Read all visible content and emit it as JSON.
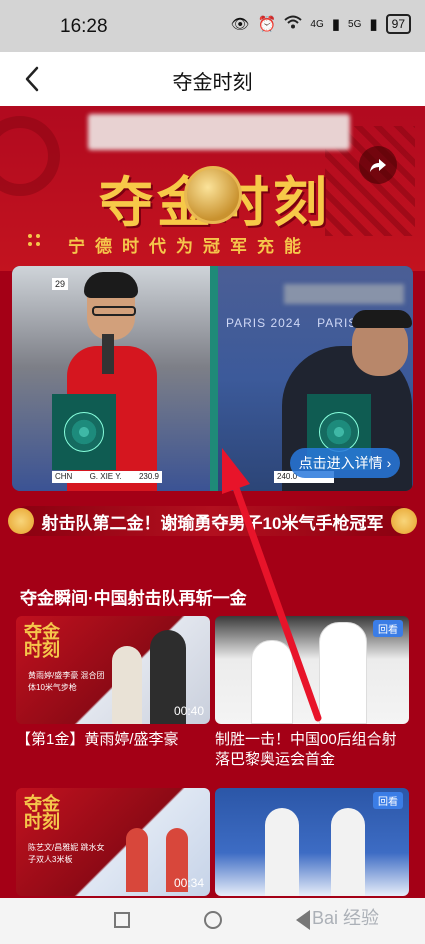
{
  "status_bar": {
    "time": "16:28",
    "signal_4g": "4G",
    "signal_5g": "5G",
    "battery": "97"
  },
  "nav": {
    "title": "夺金时刻"
  },
  "hero": {
    "title": "夺金时刻",
    "subtitle": "宁德时代为冠军充能"
  },
  "video": {
    "left_tag": "29",
    "left_score": {
      "country": "CHN",
      "name": "G. XIE Y.",
      "score": "230.9"
    },
    "right_score": "240.0",
    "paris_text": [
      "PARIS 2024",
      "PARIS 2024"
    ],
    "detail_button": "点击进入详情"
  },
  "ticker": {
    "text": "射击队第二金！谢瑜勇夺男子10米气手枪冠军"
  },
  "section": {
    "title": "夺金瞬间·中国射击队再斩一金"
  },
  "cards": [
    {
      "logo": "夺金时刻",
      "mini_text": "黄雨婷/盛李豪 混合团体10米气步枪",
      "duration": "00:40",
      "badge": "",
      "caption": "【第1金】黄雨婷/盛李豪"
    },
    {
      "logo": "",
      "mini_text": "",
      "duration": "",
      "badge": "回看",
      "caption": "制胜一击！中国00后组合射落巴黎奥运会首金"
    },
    {
      "logo": "夺金时刻",
      "mini_text": "陈艺文/昌雅妮 跳水女子双人3米板",
      "duration": "00:34",
      "badge": "",
      "caption": ""
    },
    {
      "logo": "",
      "mini_text": "",
      "duration": "",
      "badge": "回看",
      "caption": ""
    }
  ],
  "bottom_nav": {
    "watermark": "Bai 经验"
  },
  "colors": {
    "brand_red": "#a40016",
    "gold": "#f7c948",
    "button_blue": "#3b7de6",
    "arrow_red": "#e8142a"
  },
  "icons": [
    "back-arrow-icon",
    "share-icon",
    "eye-icon",
    "alarm-icon",
    "wifi-icon",
    "battery-icon",
    "square-icon",
    "circle-icon",
    "triangle-back-icon"
  ]
}
